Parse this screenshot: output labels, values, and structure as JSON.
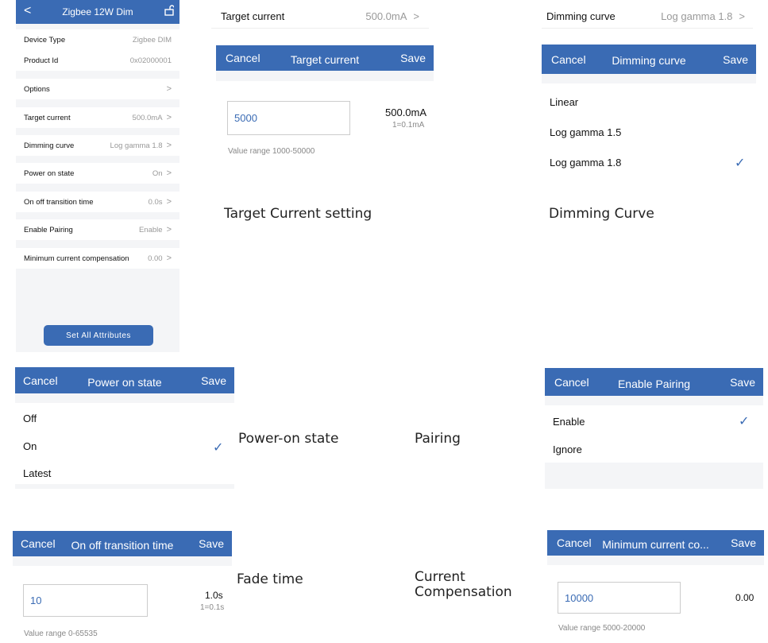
{
  "main": {
    "back": "<",
    "title": "Zigbee 12W Dim",
    "rows": [
      {
        "k": "Device Type",
        "v": "Zigbee DIM"
      },
      {
        "k": "Product Id",
        "v": "0x02000001"
      },
      {
        "k": "Options",
        "v": ""
      },
      {
        "k": "Target current",
        "v": "500.0mA"
      },
      {
        "k": "Dimming curve",
        "v": "Log gamma 1.8"
      },
      {
        "k": "Power on state",
        "v": "On"
      },
      {
        "k": "On off transition time",
        "v": "0.0s"
      },
      {
        "k": "Enable Pairing",
        "v": "Enable"
      },
      {
        "k": "Minimum current compensation",
        "v": "0.00"
      }
    ],
    "button": "Set All Attributes"
  },
  "target": {
    "row_k": "Target current",
    "row_v": "500.0mA",
    "cancel": "Cancel",
    "title": "Target current",
    "save": "Save",
    "input": "5000",
    "value": "500.0mA",
    "unit": "1=0.1mA",
    "range": "Value range 1000-50000",
    "caption": "Target Current setting"
  },
  "dimming": {
    "row_k": "Dimming curve",
    "row_v": "Log gamma 1.8",
    "cancel": "Cancel",
    "title": "Dimming curve",
    "save": "Save",
    "options": [
      "Linear",
      "Log gamma 1.5",
      "Log gamma 1.8"
    ],
    "caption": "Dimming Curve"
  },
  "power": {
    "cancel": "Cancel",
    "title": "Power on state",
    "save": "Save",
    "options": [
      "Off",
      "On",
      "Latest"
    ]
  },
  "pairing": {
    "cancel": "Cancel",
    "title": "Enable Pairing",
    "save": "Save",
    "options": [
      "Enable",
      "Ignore"
    ]
  },
  "captions": {
    "power": "Power-on state",
    "pairing": "Pairing",
    "fade": "Fade time",
    "comp": "Current Compensation"
  },
  "transition": {
    "cancel": "Cancel",
    "title": "On off transition time",
    "save": "Save",
    "input": "10",
    "value": "1.0s",
    "unit": "1=0.1s",
    "range": "Value range 0-65535"
  },
  "mincomp": {
    "cancel": "Cancel",
    "title": "Minimum current co...",
    "save": "Save",
    "input": "10000",
    "value": "0.00",
    "range": "Value range 5000-20000"
  }
}
